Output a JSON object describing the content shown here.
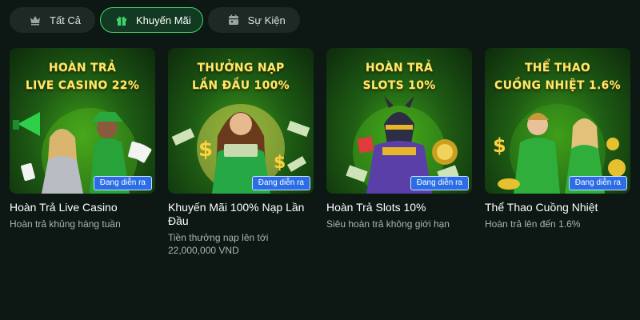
{
  "tabs": [
    {
      "label": "Tất Cả",
      "icon": "crown-icon",
      "active": false
    },
    {
      "label": "Khuyến Mãi",
      "icon": "gift-icon",
      "active": true
    },
    {
      "label": "Sự Kiện",
      "icon": "calendar-icon",
      "active": false
    }
  ],
  "colors": {
    "background": "#0d1714",
    "accent": "#3fd56a",
    "badge": "#2a6de6",
    "headline": "#ffe86a"
  },
  "promotions": [
    {
      "headline": "HOÀN TRẢ\nLIVE CASINO 22%",
      "badge": "Đang diễn ra",
      "title": "Hoàn Trả Live Casino",
      "subtitle": "Hoàn trả khủng hàng tuần"
    },
    {
      "headline": "THƯỞNG NẠP\nLẦN ĐẦU 100%",
      "badge": "Đang diễn ra",
      "title": "Khuyến Mãi 100% Nạp Lần Đầu",
      "subtitle": "Tiền thưởng nạp lên tới 22,000,000 VND"
    },
    {
      "headline": "HOÀN TRẢ\nSLOTS 10%",
      "badge": "Đang diễn ra",
      "title": "Hoàn Trả Slots 10%",
      "subtitle": "Siêu hoàn trả không giới hạn"
    },
    {
      "headline": "THỂ THAO\nCUỒNG NHIỆT 1.6%",
      "badge": "Đang diễn ra",
      "title": "Thể Thao Cuồng Nhiệt",
      "subtitle": "Hoàn trả lên đến 1.6%"
    }
  ]
}
